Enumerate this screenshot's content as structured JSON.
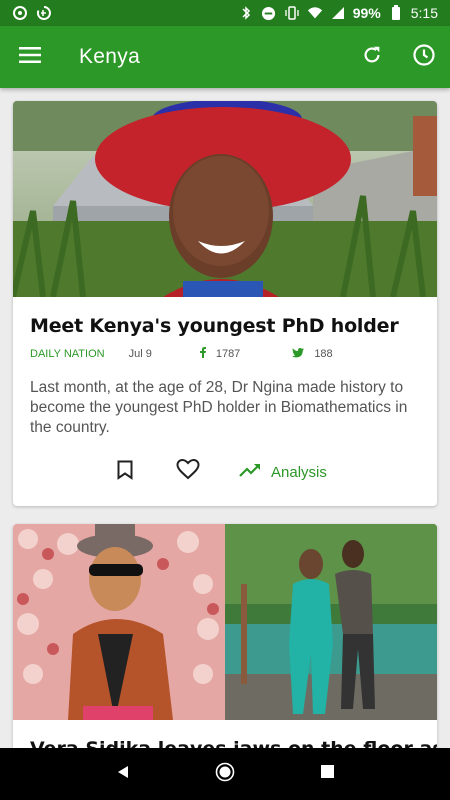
{
  "status_bar": {
    "battery_percent": "99%",
    "time": "5:15",
    "icons": [
      "sync-icon",
      "data-saver-icon",
      "bluetooth-icon",
      "do-not-disturb-icon",
      "vibrate-icon",
      "wifi-icon",
      "signal-icon",
      "battery-icon"
    ]
  },
  "app_bar": {
    "title": "Kenya",
    "icons": [
      "menu-icon",
      "refresh-icon",
      "history-icon"
    ]
  },
  "articles": [
    {
      "title": "Meet Kenya's youngest PhD holder",
      "source": "DAILY NATION",
      "date": "Jul 9",
      "facebook_count": "1787",
      "twitter_count": "188",
      "excerpt": "Last month, at the age of 28, Dr Ngina made history to become the youngest PhD holder in Biomathematics in the country.",
      "analysis_label": "Analysis"
    },
    {
      "title": "Vera Sidika leaves jaws on the floor as she"
    }
  ],
  "colors": {
    "status_bar": "#237d1f",
    "app_bar": "#2c9827",
    "accent": "#2c9827",
    "background": "#ececec"
  }
}
